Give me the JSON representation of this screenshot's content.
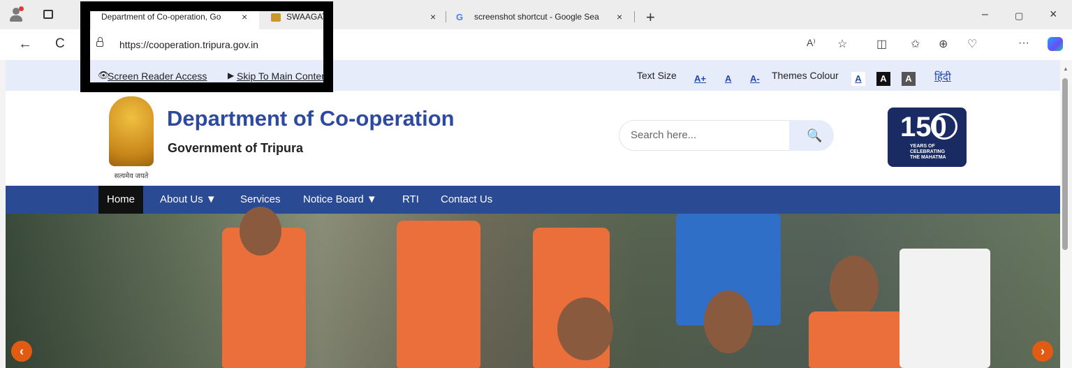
{
  "browser": {
    "tabs": [
      {
        "title": "Department of Co-operation, Go",
        "close": "×"
      },
      {
        "title": "SWAAGAT",
        "close": "×"
      },
      {
        "title": "screenshot shortcut - Google Sea",
        "close": "×"
      }
    ],
    "new_tab": "+",
    "window": {
      "minimize": "–",
      "restore": "▢",
      "close": "×"
    },
    "url": "https://cooperation.tripura.gov.in",
    "nav": {
      "back": "←",
      "reload": "C"
    },
    "toolbar_icons": [
      "A⁾",
      "☆",
      "◫",
      "✩",
      "⊕",
      "♡",
      "···"
    ]
  },
  "site": {
    "access": {
      "screen_reader": "Screen Reader Access",
      "skip": "Skip To Main Content",
      "text_size_label": "Text Size",
      "size_buttons": [
        "A+",
        "A",
        "A-"
      ],
      "themes_label": "Themes Colour",
      "theme_buttons": [
        "A",
        "A",
        "A"
      ],
      "hindi": "हिंदी"
    },
    "header": {
      "title": "Department of Co-operation",
      "subtitle": "Government of Tripura",
      "emblem_motto": "सत्यमेव जयते",
      "search_placeholder": "Search here...",
      "logo_number": "150",
      "logo_text": "YEARS OF CELEBRATING THE MAHATMA"
    },
    "menu": [
      "Home",
      "About Us ▼",
      "Services",
      "Notice Board ▼",
      "RTI",
      "Contact Us"
    ],
    "slider": {
      "prev": "‹",
      "next": "›"
    }
  },
  "colors": {
    "nav_blue": "#2a4a94",
    "title_blue": "#2d4aa0",
    "access_bg": "#e6ecf9",
    "arrow": "#e25b12"
  }
}
